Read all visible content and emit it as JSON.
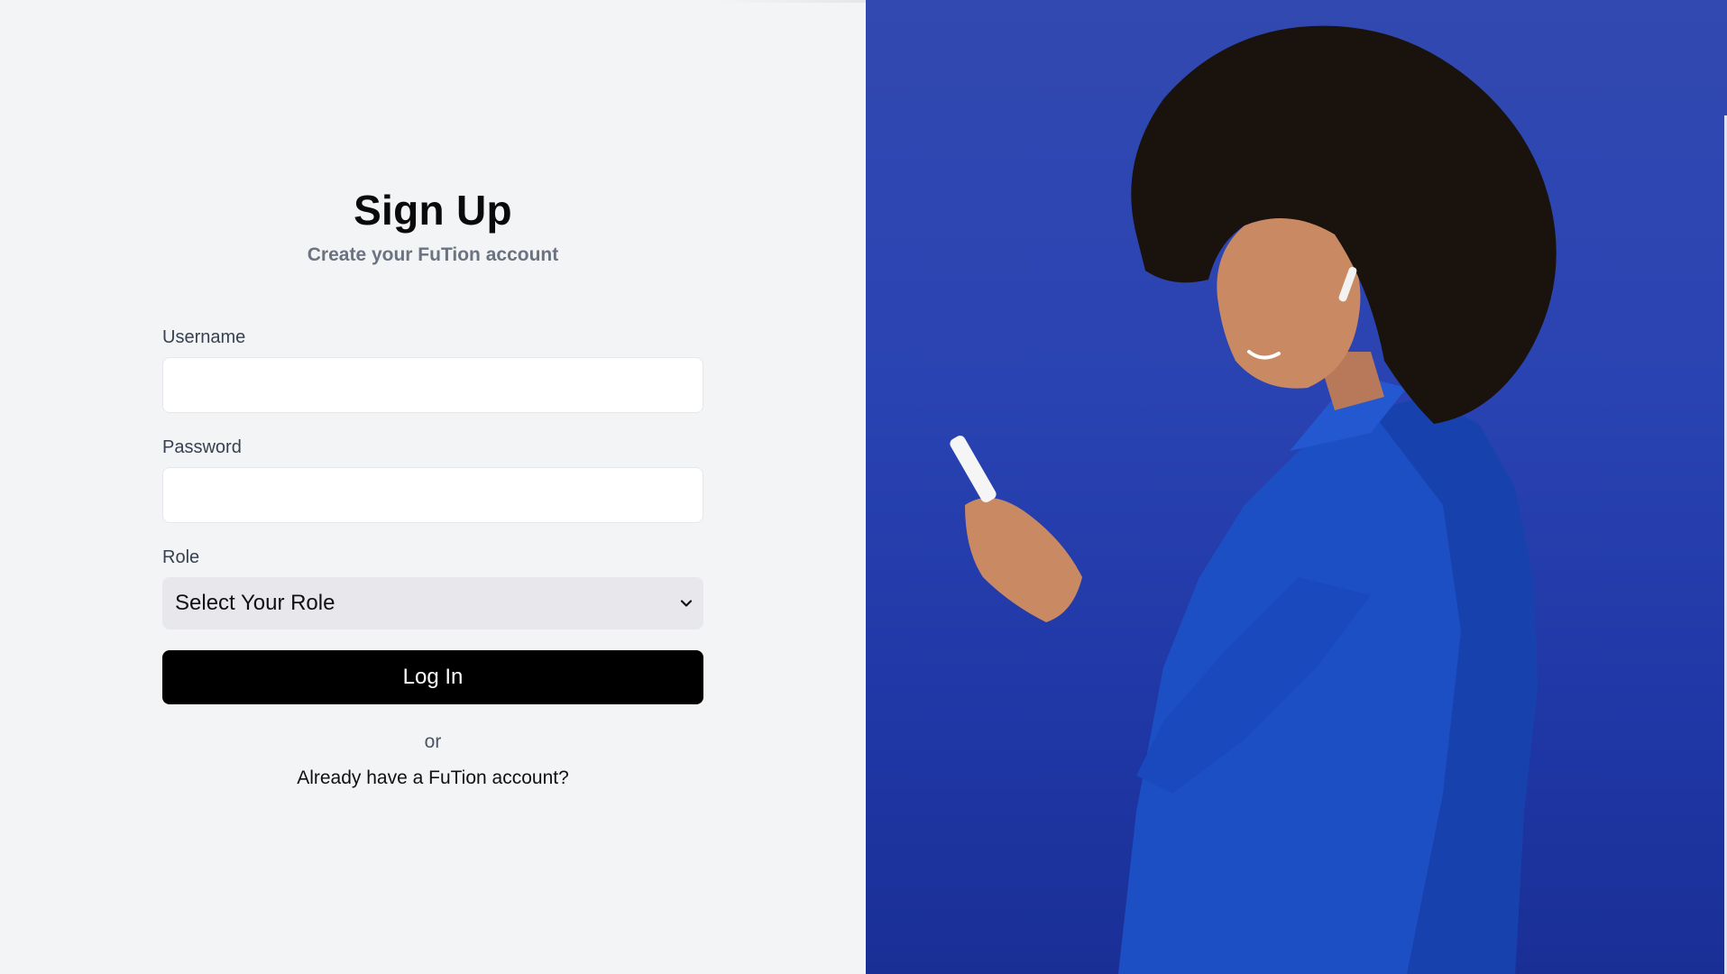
{
  "page": {
    "title": "Sign Up",
    "subtitle": "Create your FuTion account"
  },
  "form": {
    "username_label": "Username",
    "username_value": "",
    "password_label": "Password",
    "password_value": "",
    "role_label": "Role",
    "role_selected": "Select Your Role",
    "submit_label": "Log In",
    "or_text": "or",
    "signin_link": "Already have a FuTion account?"
  },
  "hero": {
    "icon": "hero-photo",
    "description_colors": {
      "background": "#2a43b2",
      "jacket": "#1d4fc4",
      "hair": "#1a120c",
      "skin": "#c98a63"
    }
  },
  "colors": {
    "page_bg": "#f3f4f6",
    "button_bg": "#000000",
    "button_text": "#ffffff",
    "select_bg": "#e8e8ec"
  }
}
